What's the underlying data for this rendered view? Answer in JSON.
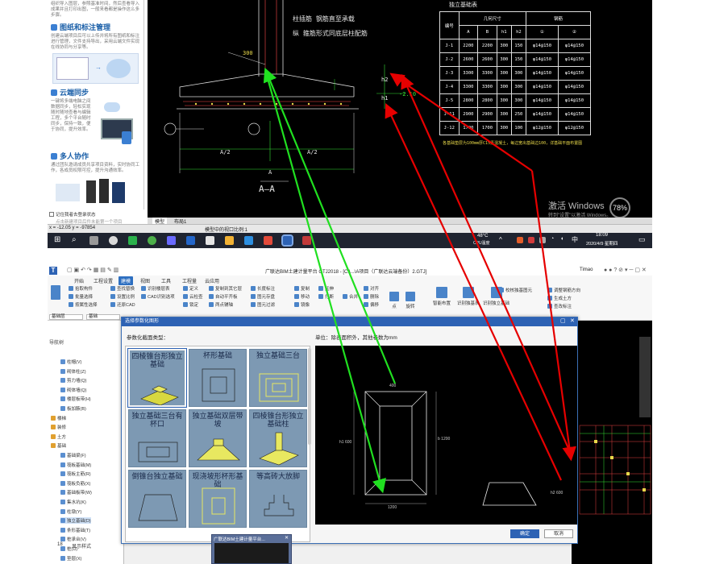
{
  "help": {
    "intro": "组织导入图层，参照基准时间，然后查看导入成果并且打印出图，一般来看都是操作这么多步骤。",
    "sections": [
      {
        "title": "图纸和标注管理",
        "text": "创建云端项目后可以上传并将所有图纸和标注进行管理，文件支持导出，采用云端文件实现在线协同与分享等。"
      },
      {
        "title": "云端同步",
        "text": "一键将多端电脑之间数据同步，轻松实现随时随地查看与编辑工程，多个平台随时同步，保持一致，便于协同，提升效率。"
      },
      {
        "title": "多人协作",
        "text": "通过团队邀请成员共享项目资料，实时协同工作，各成员权限可控，提升沟通效率。"
      }
    ],
    "remember_label": "记住我者去登录状态",
    "footer": "点击新建项目后件未能第一个项目"
  },
  "cad_top": {
    "note1": "柱插筋 钢筋直至承载",
    "note2": "纵 箍筋形式同底层柱配筋",
    "dim_300": "300",
    "dim_a2_left": "A/2",
    "dim_a2_right": "A/2",
    "dim_a": "A",
    "section_mark": "A—A",
    "label_h2": "h2",
    "label_h1": "h1",
    "elev": "-2.10",
    "table_title": "独立基础表",
    "table_header_1": [
      "编号",
      "几何尺寸",
      "",
      "",
      "",
      "钢筋",
      ""
    ],
    "table_header_2": [
      "",
      "A",
      "B",
      "h1",
      "h2",
      "①",
      "②"
    ],
    "table_rows": [
      [
        "J-1",
        "2200",
        "2200",
        "300",
        "150",
        "φ14@150",
        "φ14@150"
      ],
      [
        "J-2",
        "2600",
        "2600",
        "300",
        "150",
        "φ14@150",
        "φ14@150"
      ],
      [
        "J-3",
        "3300",
        "3300",
        "300",
        "300",
        "φ14@150",
        "φ14@150"
      ],
      [
        "J-4",
        "3300",
        "3300",
        "300",
        "300",
        "φ14@150",
        "φ14@150"
      ],
      [
        "J-5",
        "2800",
        "2800",
        "300",
        "300",
        "φ14@150",
        "φ14@150"
      ],
      [
        "J-11",
        "2900",
        "2900",
        "300",
        "250",
        "φ14@150",
        "φ14@150"
      ],
      [
        "J-12",
        "1700",
        "1700",
        "300",
        "100",
        "φ12@150",
        "φ12@150"
      ]
    ],
    "table_note": "各基础垫层为100mm厚C15素混凝土，每边宽出基础边100，详基础平面布置图",
    "activation_line1": "激活 Windows",
    "activation_line2": "转到\"设置\"以激活 Windows。",
    "tab_model": "模型",
    "tab_layout": "布局1"
  },
  "cad_status": {
    "coords": "x = -12.05  y = -97854",
    "scale": "模型中的视口比例:1"
  },
  "taskbar": {
    "temp": "48°C",
    "cpu": "CPU温度",
    "time": "18:09",
    "date": "2020/4/9 星期四",
    "lang": "中"
  },
  "app": {
    "title": "广联达BIM土建计量平台 GTJ2018 - [C:\\...\\A项目（广联达云端备份）2.GTJ]",
    "user": "Timao",
    "tabs": [
      "开始",
      "工程设置",
      "建模",
      "视图",
      "工具",
      "工程量",
      "云应用"
    ],
    "active_tab": "建模",
    "ribbon_buttons": [
      "拾取构件",
      "批量选择",
      "按属性选择",
      "查找替换",
      "设置比例",
      "还原CAD",
      "识别楼层表",
      "CAD识别选项",
      "定义",
      "云检查",
      "锁定",
      "复制到其它层",
      "自动平齐板",
      "两点辅轴",
      "长度标注",
      "图元存盘",
      "图元过滤",
      "复制",
      "移动",
      "镜像",
      "延伸",
      "打断",
      "合并",
      "对齐",
      "删除",
      "偏移",
      "点",
      "旋转",
      "智能布置",
      "识别独基表",
      "识别独立基础",
      "校核独基图元",
      "调整钢筋方向",
      "生成土方",
      "查改标注"
    ],
    "floor_select": "基础层",
    "type_select": "基础",
    "nav_title": "导航树",
    "tree": [
      {
        "label": "柱帽(V)",
        "group": false
      },
      {
        "label": "砌体柱(Z)",
        "group": false
      },
      {
        "label": "剪力墙(Q)",
        "group": false
      },
      {
        "label": "砌体墙(Q)",
        "group": false
      },
      {
        "label": "楼层板带(H)",
        "group": false
      },
      {
        "label": "板加腋(B)",
        "group": false
      },
      {
        "label": "楼梯",
        "group": true
      },
      {
        "label": "装修",
        "group": true
      },
      {
        "label": "土方",
        "group": true
      },
      {
        "label": "基础",
        "group": true
      },
      {
        "label": "基础梁(F)",
        "group": false
      },
      {
        "label": "筏板基础(M)",
        "group": false
      },
      {
        "label": "筏板主筋(R)",
        "group": false
      },
      {
        "label": "筏板负筋(X)",
        "group": false
      },
      {
        "label": "基础板带(W)",
        "group": false
      },
      {
        "label": "集水坑(K)",
        "group": false
      },
      {
        "label": "柱墩(Y)",
        "group": false
      },
      {
        "label": "独立基础(D)",
        "group": false,
        "selected": true
      },
      {
        "label": "条形基础(T)",
        "group": false
      },
      {
        "label": "桩承台(V)",
        "group": false
      },
      {
        "label": "桩(U)",
        "group": false
      },
      {
        "label": "垫层(X)",
        "group": false
      }
    ],
    "grid_footer": "显示样式",
    "grid_footer_num": "18"
  },
  "dialog": {
    "title": "选择参数化图形",
    "section_label": "参数化截面类型：",
    "unit_note": "单位：除表面积外，其他参数为mm",
    "thumbs": [
      {
        "label": "四棱锥台形独立基础"
      },
      {
        "label": "杯形基础"
      },
      {
        "label": "独立基础三台"
      },
      {
        "label": "独立基础三台有杯口"
      },
      {
        "label": "独立基础双层带坡"
      },
      {
        "label": "四棱锥台形独立基础柱"
      },
      {
        "label": "倒锥台独立基础"
      },
      {
        "label": "现浇坡形杯形基础"
      },
      {
        "label": "等高砖大放脚"
      }
    ],
    "preview_dim_b": "b 1200",
    "preview_dim_a": "1200",
    "preview_h1": "h1 600",
    "preview_h2": "h2 600",
    "confirm": "确定",
    "cancel": "取消"
  },
  "mini_window": {
    "label": "广联达BIM土建计量平台..."
  },
  "colors": {
    "red_arrow": "#e60000",
    "green_arrow": "#20e020",
    "accent": "#2d62b4"
  }
}
